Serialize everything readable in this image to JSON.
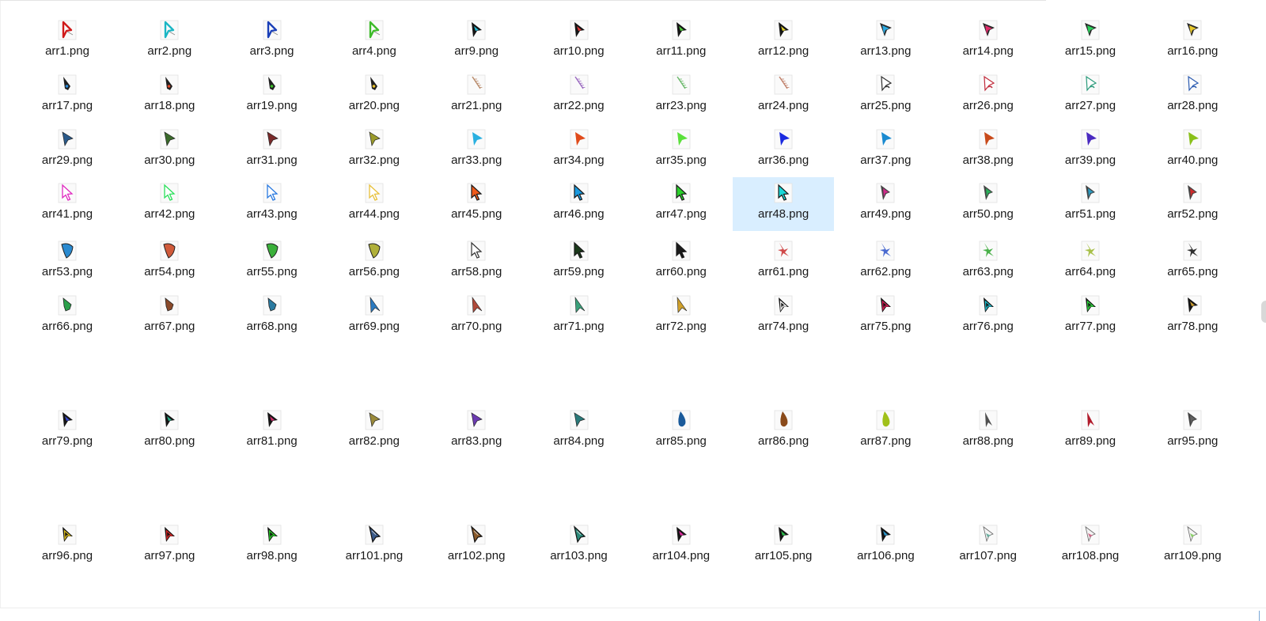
{
  "window": {
    "title": ""
  },
  "selected_file": "arr48.png",
  "files": [
    {
      "name": "arr1.png",
      "icon": "cursor-icon",
      "style": "outline",
      "color": "#d01a1a"
    },
    {
      "name": "arr2.png",
      "icon": "cursor-icon",
      "style": "outline",
      "color": "#1ab6c4"
    },
    {
      "name": "arr3.png",
      "icon": "cursor-icon",
      "style": "outline",
      "color": "#1a3fb8"
    },
    {
      "name": "arr4.png",
      "icon": "cursor-icon",
      "style": "outline",
      "color": "#3dbb2a"
    },
    {
      "name": "arr9.png",
      "icon": "cursor-icon",
      "style": "dark",
      "color": "#28c0d8"
    },
    {
      "name": "arr10.png",
      "icon": "cursor-icon",
      "style": "dark",
      "color": "#e23a3a"
    },
    {
      "name": "arr11.png",
      "icon": "cursor-icon",
      "style": "dark",
      "color": "#4ccf3a"
    },
    {
      "name": "arr12.png",
      "icon": "cursor-icon",
      "style": "dark",
      "color": "#e6d52a"
    },
    {
      "name": "arr13.png",
      "icon": "cursor-icon",
      "style": "glow",
      "color": "#2aa8e0"
    },
    {
      "name": "arr14.png",
      "icon": "cursor-icon",
      "style": "glow",
      "color": "#e02a6a"
    },
    {
      "name": "arr15.png",
      "icon": "cursor-icon",
      "style": "glow",
      "color": "#2ad05a"
    },
    {
      "name": "arr16.png",
      "icon": "cursor-icon",
      "style": "glow",
      "color": "#e8c82a"
    },
    {
      "name": "arr17.png",
      "icon": "cursor-icon",
      "style": "rocket",
      "color": "#2a8ad8"
    },
    {
      "name": "arr18.png",
      "icon": "cursor-icon",
      "style": "rocket",
      "color": "#e04a2a"
    },
    {
      "name": "arr19.png",
      "icon": "cursor-icon",
      "style": "rocket",
      "color": "#3ac02a"
    },
    {
      "name": "arr20.png",
      "icon": "cursor-icon",
      "style": "rocket",
      "color": "#e8c02a"
    },
    {
      "name": "arr21.png",
      "icon": "cursor-icon",
      "style": "feather",
      "color": "#b88a6a"
    },
    {
      "name": "arr22.png",
      "icon": "cursor-icon",
      "style": "feather",
      "color": "#9a6ac0"
    },
    {
      "name": "arr23.png",
      "icon": "cursor-icon",
      "style": "feather",
      "color": "#6ab86a"
    },
    {
      "name": "arr24.png",
      "icon": "cursor-icon",
      "style": "feather",
      "color": "#c0806a"
    },
    {
      "name": "arr25.png",
      "icon": "cursor-icon",
      "style": "wire",
      "color": "#303030"
    },
    {
      "name": "arr26.png",
      "icon": "cursor-icon",
      "style": "wire",
      "color": "#c02a3a"
    },
    {
      "name": "arr27.png",
      "icon": "cursor-icon",
      "style": "wire",
      "color": "#2a9a7a"
    },
    {
      "name": "arr28.png",
      "icon": "cursor-icon",
      "style": "wire",
      "color": "#2a5ab0"
    },
    {
      "name": "arr29.png",
      "icon": "cursor-icon",
      "style": "solid",
      "color": "#2a5a8a"
    },
    {
      "name": "arr30.png",
      "icon": "cursor-icon",
      "style": "solid",
      "color": "#3a6a2a"
    },
    {
      "name": "arr31.png",
      "icon": "cursor-icon",
      "style": "solid",
      "color": "#7a2a2a"
    },
    {
      "name": "arr32.png",
      "icon": "cursor-icon",
      "style": "solid",
      "color": "#9a9a2a"
    },
    {
      "name": "arr33.png",
      "icon": "cursor-icon",
      "style": "flat",
      "color": "#2ab0e0"
    },
    {
      "name": "arr34.png",
      "icon": "cursor-icon",
      "style": "flat",
      "color": "#e04a1a"
    },
    {
      "name": "arr35.png",
      "icon": "cursor-icon",
      "style": "flat",
      "color": "#5ae03a"
    },
    {
      "name": "arr36.png",
      "icon": "cursor-icon",
      "style": "flat",
      "color": "#1a2ae0"
    },
    {
      "name": "arr37.png",
      "icon": "cursor-icon",
      "style": "flat",
      "color": "#1a8ad0"
    },
    {
      "name": "arr38.png",
      "icon": "cursor-icon",
      "style": "flat",
      "color": "#c84a1a"
    },
    {
      "name": "arr39.png",
      "icon": "cursor-icon",
      "style": "flat",
      "color": "#4a2ac0"
    },
    {
      "name": "arr40.png",
      "icon": "cursor-icon",
      "style": "flat",
      "color": "#8ac01a"
    },
    {
      "name": "arr41.png",
      "icon": "cursor-icon",
      "style": "pointer",
      "color": "#e02ac0"
    },
    {
      "name": "arr42.png",
      "icon": "cursor-icon",
      "style": "pointer",
      "color": "#2ae05a"
    },
    {
      "name": "arr43.png",
      "icon": "cursor-icon",
      "style": "pointer",
      "color": "#2a7ae0"
    },
    {
      "name": "arr44.png",
      "icon": "cursor-icon",
      "style": "pointer",
      "color": "#e8c03a"
    },
    {
      "name": "arr45.png",
      "icon": "cursor-icon",
      "style": "pointer-fill",
      "color": "#f05a1a"
    },
    {
      "name": "arr46.png",
      "icon": "cursor-icon",
      "style": "pointer-fill",
      "color": "#1a9ae0"
    },
    {
      "name": "arr47.png",
      "icon": "cursor-icon",
      "style": "pointer-fill",
      "color": "#2ad02a"
    },
    {
      "name": "arr48.png",
      "icon": "cursor-icon",
      "style": "pointer-fill",
      "color": "#1ad8d8"
    },
    {
      "name": "arr49.png",
      "icon": "cursor-icon",
      "style": "glass",
      "color": "#d02a8a"
    },
    {
      "name": "arr50.png",
      "icon": "cursor-icon",
      "style": "glass",
      "color": "#2ab05a"
    },
    {
      "name": "arr51.png",
      "icon": "cursor-icon",
      "style": "glass",
      "color": "#2a9ac0"
    },
    {
      "name": "arr52.png",
      "icon": "cursor-icon",
      "style": "glass",
      "color": "#d02a2a"
    },
    {
      "name": "arr53.png",
      "icon": "cursor-icon",
      "style": "leaf",
      "color": "#2a8ad0"
    },
    {
      "name": "arr54.png",
      "icon": "cursor-icon",
      "style": "leaf",
      "color": "#d05a3a"
    },
    {
      "name": "arr55.png",
      "icon": "cursor-icon",
      "style": "leaf",
      "color": "#3ab03a"
    },
    {
      "name": "arr56.png",
      "icon": "cursor-icon",
      "style": "leaf",
      "color": "#b0b03a"
    },
    {
      "name": "arr58.png",
      "icon": "cursor-icon",
      "style": "pointer-fill",
      "color": "#ffffff"
    },
    {
      "name": "arr59.png",
      "icon": "cursor-icon",
      "style": "pointer-fill",
      "color": "#1a3a1a"
    },
    {
      "name": "arr60.png",
      "icon": "cursor-icon",
      "style": "pointer-fill",
      "color": "#1a1a1a"
    },
    {
      "name": "arr61.png",
      "icon": "cursor-icon",
      "style": "splash",
      "color": "#d04a4a"
    },
    {
      "name": "arr62.png",
      "icon": "cursor-icon",
      "style": "splash",
      "color": "#4a6ad0"
    },
    {
      "name": "arr63.png",
      "icon": "cursor-icon",
      "style": "splash",
      "color": "#4ab04a"
    },
    {
      "name": "arr64.png",
      "icon": "cursor-icon",
      "style": "splash",
      "color": "#a8c04a"
    },
    {
      "name": "arr65.png",
      "icon": "cursor-icon",
      "style": "splash",
      "color": "#303030"
    },
    {
      "name": "arr66.png",
      "icon": "cursor-icon",
      "style": "bug",
      "color": "#2aa04a"
    },
    {
      "name": "arr67.png",
      "icon": "cursor-icon",
      "style": "bug",
      "color": "#8a4a2a"
    },
    {
      "name": "arr68.png",
      "icon": "cursor-icon",
      "style": "bug",
      "color": "#2a7aa0"
    },
    {
      "name": "arr69.png",
      "icon": "cursor-icon",
      "style": "dart",
      "color": "#2a7ac0"
    },
    {
      "name": "arr70.png",
      "icon": "cursor-icon",
      "style": "dart",
      "color": "#b04a3a"
    },
    {
      "name": "arr71.png",
      "icon": "cursor-icon",
      "style": "dart",
      "color": "#3aa07a"
    },
    {
      "name": "arr72.png",
      "icon": "cursor-icon",
      "style": "dart",
      "color": "#d0a02a"
    },
    {
      "name": "arr74.png",
      "icon": "cursor-icon",
      "style": "neon",
      "color": "#ffffff"
    },
    {
      "name": "arr75.png",
      "icon": "cursor-icon",
      "style": "neon",
      "color": "#e0205a"
    },
    {
      "name": "arr76.png",
      "icon": "cursor-icon",
      "style": "neon",
      "color": "#20c0d0"
    },
    {
      "name": "arr77.png",
      "icon": "cursor-icon",
      "style": "neon",
      "color": "#30e040"
    },
    {
      "name": "arr78.png",
      "icon": "cursor-icon",
      "style": "dark",
      "color": "#d0a030"
    },
    {
      "name": "arr79.png",
      "icon": "cursor-icon",
      "style": "dark",
      "color": "#3a4ad0"
    },
    {
      "name": "arr80.png",
      "icon": "cursor-icon",
      "style": "dark",
      "color": "#2ab08a"
    },
    {
      "name": "arr81.png",
      "icon": "cursor-icon",
      "style": "dark",
      "color": "#d02a6a"
    },
    {
      "name": "arr82.png",
      "icon": "cursor-icon",
      "style": "solid",
      "color": "#9a8a3a"
    },
    {
      "name": "arr83.png",
      "icon": "cursor-icon",
      "style": "solid",
      "color": "#6a3ab0"
    },
    {
      "name": "arr84.png",
      "icon": "cursor-icon",
      "style": "solid",
      "color": "#2a7a7a"
    },
    {
      "name": "arr85.png",
      "icon": "cursor-icon",
      "style": "drop",
      "color": "#1a5a9a"
    },
    {
      "name": "arr86.png",
      "icon": "cursor-icon",
      "style": "drop",
      "color": "#8a4a1a"
    },
    {
      "name": "arr87.png",
      "icon": "cursor-icon",
      "style": "drop",
      "color": "#a0c01a"
    },
    {
      "name": "arr88.png",
      "icon": "cursor-icon",
      "style": "thin",
      "color": "#505050"
    },
    {
      "name": "arr89.png",
      "icon": "cursor-icon",
      "style": "thin",
      "color": "#b01a2a"
    },
    {
      "name": "arr95.png",
      "icon": "cursor-icon",
      "style": "glass",
      "color": "#606060"
    },
    {
      "name": "arr96.png",
      "icon": "cursor-icon",
      "style": "neon",
      "color": "#e0c020"
    },
    {
      "name": "arr97.png",
      "icon": "cursor-icon",
      "style": "neon",
      "color": "#e02a2a"
    },
    {
      "name": "arr98.png",
      "icon": "cursor-icon",
      "style": "neon",
      "color": "#2ad02a"
    },
    {
      "name": "arr101.png",
      "icon": "cursor-icon",
      "style": "metal",
      "color": "#3a5a8a"
    },
    {
      "name": "arr102.png",
      "icon": "cursor-icon",
      "style": "metal",
      "color": "#8a5a2a"
    },
    {
      "name": "arr103.png",
      "icon": "cursor-icon",
      "style": "metal",
      "color": "#2a8a7a"
    },
    {
      "name": "arr104.png",
      "icon": "cursor-icon",
      "style": "dark",
      "color": "#e02aa0"
    },
    {
      "name": "arr105.png",
      "icon": "cursor-icon",
      "style": "dark",
      "color": "#2ac04a"
    },
    {
      "name": "arr106.png",
      "icon": "cursor-icon",
      "style": "dark",
      "color": "#2a9ad0"
    },
    {
      "name": "arr107.png",
      "icon": "cursor-icon",
      "style": "gradient",
      "color": "#6ab0a0"
    },
    {
      "name": "arr108.png",
      "icon": "cursor-icon",
      "style": "gradient",
      "color": "#d06a8a"
    },
    {
      "name": "arr109.png",
      "icon": "cursor-icon",
      "style": "gradient",
      "color": "#8ad06a"
    }
  ]
}
